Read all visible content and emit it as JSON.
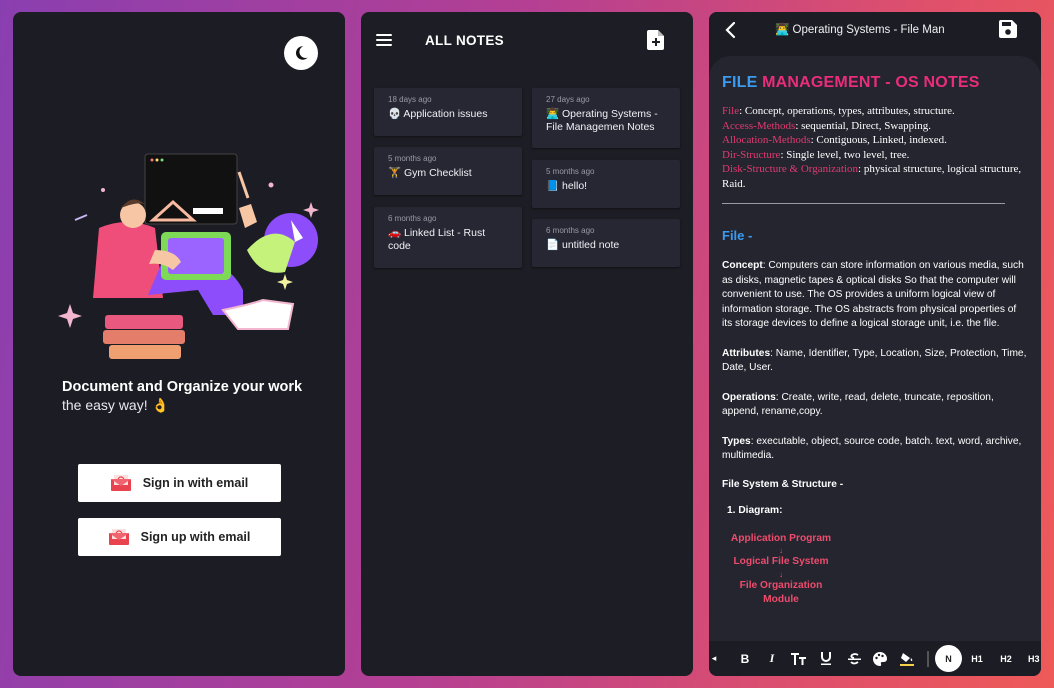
{
  "auth": {
    "theme_toggle": "moon-icon",
    "tagline_bold": "Document and Organize your work",
    "tagline_rest": "the easy way! 👌",
    "signin_label": "Sign in with email",
    "signup_label": "Sign up with email"
  },
  "notes": {
    "title": "ALL NOTES",
    "items": [
      {
        "ago": "18 days ago",
        "title": "💀 Application issues"
      },
      {
        "ago": "5 months ago",
        "title": "🏋️ Gym Checklist"
      },
      {
        "ago": "6 months ago",
        "title": "🚗 Linked List - Rust code"
      },
      {
        "ago": "27 days ago",
        "title": "👨‍💻 Operating Systems - File Managemen Notes"
      },
      {
        "ago": "5 months ago",
        "title": "📘 hello!"
      },
      {
        "ago": "6 months ago",
        "title": "📄 untitled note"
      }
    ]
  },
  "editor": {
    "title": "👨‍💻 Operating Systems - File Management Notes",
    "heading_part1": "FILE",
    "heading_part2": "MANAGEMENT - OS NOTES",
    "summary": [
      {
        "key": "File",
        "text": ": Concept, operations, types, attributes, structure."
      },
      {
        "key": "Access-Methods",
        "text": ": sequential, Direct, Swapping."
      },
      {
        "key": "Allocation-Methods",
        "text": ": Contiguous, Linked, indexed."
      },
      {
        "key": "Dir-Structure",
        "text": ": Single level, two level, tree."
      },
      {
        "key": "Disk-Structure & Organization",
        "text": ": physical structure, logical structure, Raid."
      }
    ],
    "file_heading": "File -",
    "paragraphs": [
      {
        "key": "Concept",
        "text": ": Computers can store information on various media, such as disks, magnetic tapes & optical disks So that the computer will convenient to use. The OS provides a uniform logical view of information storage. The OS abstracts from physical properties of its storage devices to define a logical storage unit, i.e. the file."
      },
      {
        "key": "Attributes",
        "text": ": Name, Identifier, Type, Location, Size, Protection, Time, Date, User."
      },
      {
        "key": "Operations",
        "text": ": Create, write, read, delete, truncate, reposition, append, rename,copy."
      },
      {
        "key": "Types",
        "text": ": executable, object, source code, batch. text, word, archive, multimedia."
      }
    ],
    "subheading": "File System & Structure -",
    "diagram_heading": "1. Diagram:",
    "diagram_rows": [
      "Application Program",
      "Logical File System",
      "File Organization Module"
    ],
    "toolbar": {
      "bold": "B",
      "italic": "I",
      "normal": "N",
      "h1": "H1",
      "h2": "H2",
      "h3": "H3"
    }
  },
  "colors": {
    "accent_blue": "#3a9bf2",
    "accent_pink": "#ea2d7a",
    "key_red": "#e03a6f",
    "panel": "#1c1c24",
    "card": "#272734"
  }
}
